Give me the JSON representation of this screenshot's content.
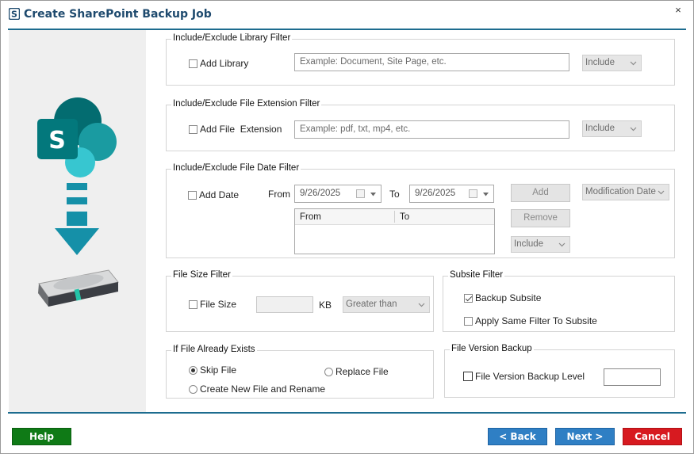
{
  "window": {
    "title": "Create SharePoint Backup Job",
    "close_glyph": "×",
    "icon": "sharepoint-s-icon"
  },
  "library_filter": {
    "title": "Include/Exclude Library Filter",
    "checkbox_label": "Add Library",
    "checked": false,
    "placeholder": "Example: Document, Site Page, etc.",
    "mode": "Include"
  },
  "extension_filter": {
    "title": "Include/Exclude File Extension Filter",
    "checkbox_label": "Add File  Extension",
    "checked": false,
    "placeholder": "Example: pdf, txt, mp4, etc.",
    "mode": "Include"
  },
  "date_filter": {
    "title": "Include/Exclude File Date Filter",
    "checkbox_label": "Add Date",
    "checked": false,
    "from_label": "From",
    "from_value": "9/26/2025",
    "to_label": "To",
    "to_value": "9/26/2025",
    "add_button": "Add",
    "remove_button": "Remove",
    "date_type": "Modification Date",
    "mode": "Include",
    "columns": [
      "From",
      "To"
    ],
    "rows": []
  },
  "size_filter": {
    "title": "File Size Filter",
    "checkbox_label": "File Size",
    "checked": false,
    "value": "",
    "unit": "KB",
    "comparison": "Greater than"
  },
  "subsite_filter": {
    "title": "Subsite Filter",
    "backup_subsite_label": "Backup Subsite",
    "backup_subsite_checked": true,
    "apply_same_label": "Apply Same Filter To Subsite",
    "apply_same_checked": false
  },
  "file_exists": {
    "title": "If File Already Exists",
    "options": [
      "Skip File",
      "Replace File",
      "Create New File and Rename"
    ],
    "selected": "Skip File"
  },
  "version_backup": {
    "title": "File Version Backup",
    "checkbox_label": "File Version Backup Level",
    "checked": false,
    "value": ""
  },
  "footer": {
    "help": "Help",
    "back": "< Back",
    "next": "Next >",
    "cancel": "Cancel"
  },
  "colors": {
    "title_text": "#1e4a6e",
    "rule": "#1d6c8f",
    "help": "#0f7a16",
    "nav": "#2f7fc4",
    "cancel": "#d71a20",
    "sharepoint_teal": "#03787c"
  }
}
